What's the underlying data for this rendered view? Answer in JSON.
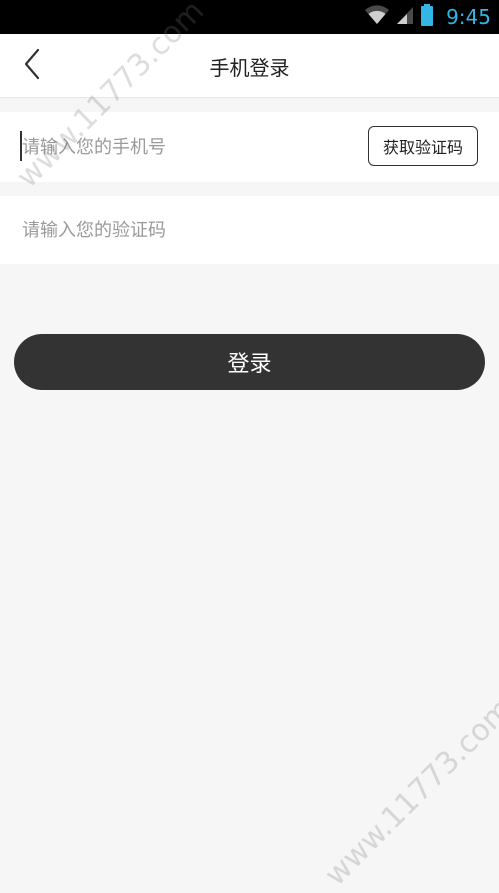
{
  "status_bar": {
    "time": "9:45",
    "icons": [
      "wifi-icon",
      "cell-signal-icon",
      "battery-icon"
    ],
    "accent_color": "#33b5e5"
  },
  "header": {
    "title": "手机登录",
    "back_icon": "chevron-left-icon"
  },
  "form": {
    "phone": {
      "placeholder": "请输入您的手机号",
      "value": ""
    },
    "get_code_label": "获取验证码",
    "code": {
      "placeholder": "请输入您的验证码",
      "value": ""
    },
    "login_label": "登录"
  },
  "watermark": {
    "text": "www.11773.com"
  },
  "colors": {
    "background": "#f6f6f6",
    "button_dark": "#333333"
  }
}
